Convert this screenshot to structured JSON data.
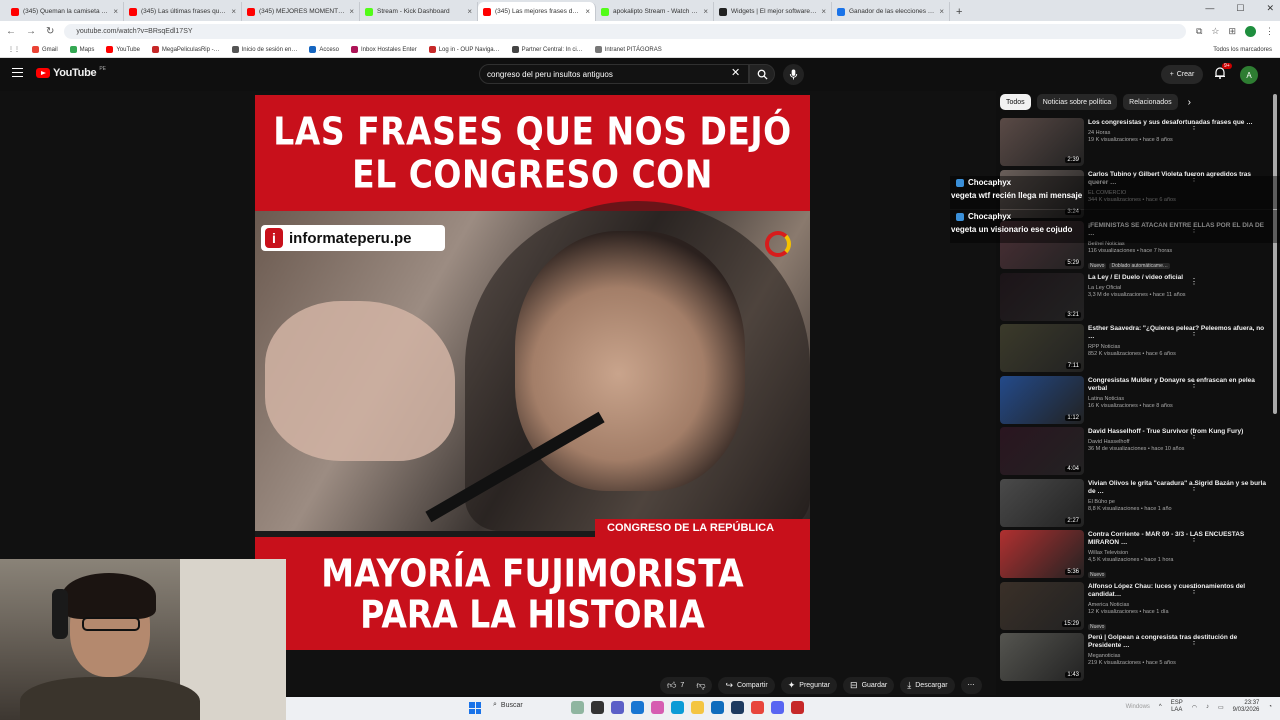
{
  "browser": {
    "tabs": [
      {
        "label": "(345) Queman la camiseta de M…",
        "color": "#ff0000"
      },
      {
        "label": "(345) Las últimas frases que gu…",
        "color": "#ff0000"
      },
      {
        "label": "(345) MEJORES MOMENTOS DE…",
        "color": "#ff0000"
      },
      {
        "label": "Stream - Kick Dashboard",
        "color": "#53fc18"
      },
      {
        "label": "(345) Las mejores frases de…",
        "color": "#ff0000",
        "active": true
      },
      {
        "label": "apokalipto Stream - Watch Liv…",
        "color": "#53fc18"
      },
      {
        "label": "Widgets | El mejor software pa…",
        "color": "#222222"
      },
      {
        "label": "Ganador de las elecciones pres…",
        "color": "#1a73e8"
      }
    ],
    "url": "youtube.com/watch?v=BRsqEdl17SY",
    "profile_initial": "",
    "bookmarks": [
      {
        "label": "Gmail",
        "color": "#ea4335"
      },
      {
        "label": "Maps",
        "color": "#34a853"
      },
      {
        "label": "YouTube",
        "color": "#ff0000"
      },
      {
        "label": "MegaPeliculasRip -…",
        "color": "#c62828"
      },
      {
        "label": "Inicio de sesión en…",
        "color": "#555555"
      },
      {
        "label": "Acceso",
        "color": "#1565c0"
      },
      {
        "label": "Inbox Hostales Enter",
        "color": "#ad1457"
      },
      {
        "label": "Log in - OUP Naviga…",
        "color": "#c62828"
      },
      {
        "label": "Partner Central: In ci…",
        "color": "#444444"
      },
      {
        "label": "Intranet PITÁGORAS",
        "color": "#777777"
      }
    ],
    "bookmarks_all": "Todos los marcadores"
  },
  "youtube": {
    "logo_text": "YouTube",
    "country": "PE",
    "search_value": "congreso del peru insultos  antiguos",
    "create_label": "Crear",
    "notif_count": "9+",
    "avatar_initial": "A"
  },
  "video": {
    "top_line1": "LAS FRASES QUE NOS DEJÓ",
    "top_line2": "EL CONGRESO CON",
    "badge": "informateperu.pe",
    "strip": "CONGRESO DE LA REPÚBLICA",
    "bottom_line1": "MAYORÍA FUJIMORISTA",
    "bottom_line2": "PARA LA HISTORIA"
  },
  "actions": {
    "likes": "7",
    "share": "Compartir",
    "ask": "Preguntar",
    "save": "Guardar",
    "download": "Descargar"
  },
  "chips": [
    "Todos",
    "Noticias sobre política",
    "Relacionados"
  ],
  "recs": [
    {
      "title": "Los congresistas y sus desafortunadas frases que …",
      "channel": "24 Horas",
      "views": "19 K visualizaciones • hace 8 años",
      "duration": "2:39",
      "thumb": "#5a4a46"
    },
    {
      "title": "Carlos Tubino y Gilbert Violeta fueron agredidos tras querer …",
      "channel": "EL COMERCIO",
      "views": "344 K visualizaciones • hace 6 años",
      "duration": "3:24",
      "thumb": "#6a5f5a"
    },
    {
      "title": "¡FEMINISTAS SE ATACAN ENTRE ELLAS POR EL DÍA DE …",
      "channel": "Bethel Noticias",
      "views": "116 visualizaciones • hace 7 horas",
      "duration": "5:29",
      "thumb": "#4a2f35",
      "badge": "Nuevo",
      "extra": "Doblado automáticame…"
    },
    {
      "title": "La Ley / El Duelo / video oficial",
      "channel": "La Ley Oficial",
      "views": "3,3 M de visualizaciones • hace 11 años",
      "duration": "3:21",
      "thumb": "#1c1418"
    },
    {
      "title": "Esther Saavedra: \"¿Quieres pelear? Peleemos afuera, no …",
      "channel": "RPP Noticias",
      "views": "852 K visualizaciones • hace 6 años",
      "duration": "7:11",
      "thumb": "#3b3a2a"
    },
    {
      "title": "Congresistas Mulder y Donayre se enfrascan en pelea verbal",
      "channel": "Latina Noticias",
      "views": "16 K visualizaciones • hace 8 años",
      "duration": "1:12",
      "thumb": "#234a8a"
    },
    {
      "title": "David Hasselhoff - True Survivor (from Kung Fury)",
      "channel": "David Hasselhoff",
      "views": "36 M de visualizaciones • hace 10 años",
      "duration": "4:04",
      "thumb": "#2a1520"
    },
    {
      "title": "Vivian Olivos le grita \"caradura\" a Sigrid Bazán y se burla de …",
      "channel": "El Búho pe",
      "views": "8,8 K visualizaciones • hace 1 año",
      "duration": "2:27",
      "thumb": "#4a4a4a"
    },
    {
      "title": "Contra Corriente - MAR 09 - 3/3 - LAS ENCUESTAS MIRARON …",
      "channel": "Willax Television",
      "views": "4,5 K visualizaciones • hace 1 hora",
      "duration": "5:36",
      "thumb": "#b03030",
      "badge": "Nuevo"
    },
    {
      "title": "Alfonso López Chau: luces y cuestionamientos del candidat…",
      "channel": "America Noticias",
      "views": "12 K visualizaciones • hace 1 día",
      "duration": "15:29",
      "thumb": "#3a3028",
      "badge": "Nuevo"
    },
    {
      "title": "Perú | Golpean a congresista tras destitución de Presidente …",
      "channel": "Meganoticias",
      "views": "219 K visualizaciones • hace 5 años",
      "duration": "1:43",
      "thumb": "#555550"
    }
  ],
  "chat": [
    {
      "user": "Chocaphyx",
      "text": "vegeta wtf recién llega mi mensaje"
    },
    {
      "user": "Chocaphyx",
      "text": "vegeta un visionario ese cojudo"
    }
  ],
  "taskbar": {
    "search": "Buscar",
    "lang1": "ESP",
    "lang2": "LAA",
    "time": "23:37",
    "date": "9/03/2026",
    "watermark": "Windows"
  }
}
